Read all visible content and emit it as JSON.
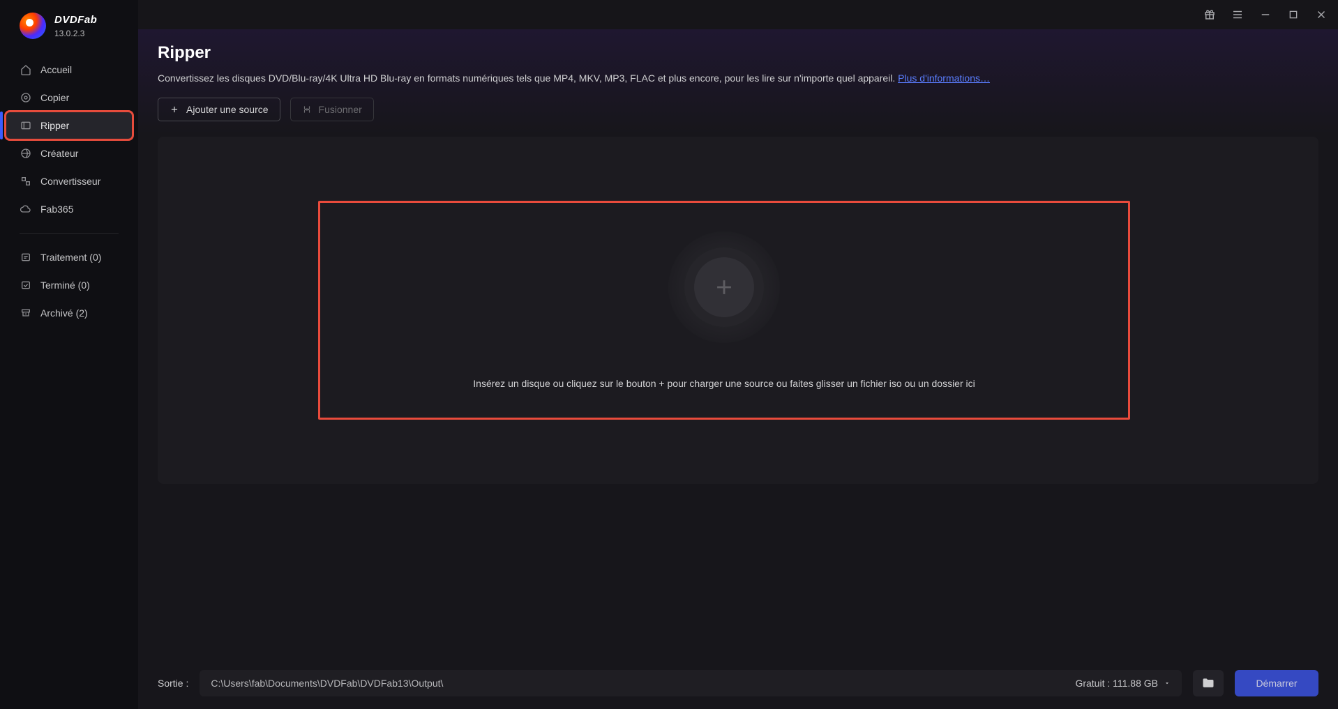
{
  "brand": {
    "name": "DVDFab",
    "version": "13.0.2.3"
  },
  "sidebar": {
    "items": [
      {
        "label": "Accueil"
      },
      {
        "label": "Copier"
      },
      {
        "label": "Ripper"
      },
      {
        "label": "Créateur"
      },
      {
        "label": "Convertisseur"
      },
      {
        "label": "Fab365"
      }
    ],
    "status": [
      {
        "label": "Traitement (0)"
      },
      {
        "label": "Terminé (0)"
      },
      {
        "label": "Archivé (2)"
      }
    ]
  },
  "page": {
    "title": "Ripper",
    "description": "Convertissez les disques DVD/Blu-ray/4K Ultra HD Blu-ray en formats numériques tels que MP4, MKV, MP3, FLAC et plus encore, pour les lire sur n'importe quel appareil. ",
    "more_link": "Plus d'informations…"
  },
  "actions": {
    "add_source": "Ajouter une source",
    "merge": "Fusionner"
  },
  "dropzone": {
    "text": "Insérez un disque ou cliquez sur le bouton +  pour charger une source ou faites glisser un fichier iso ou un dossier ici"
  },
  "footer": {
    "label": "Sortie :",
    "path": "C:\\Users\\fab\\Documents\\DVDFab\\DVDFab13\\Output\\",
    "free_space": "Gratuit : 111.88 GB",
    "start": "Démarrer"
  }
}
